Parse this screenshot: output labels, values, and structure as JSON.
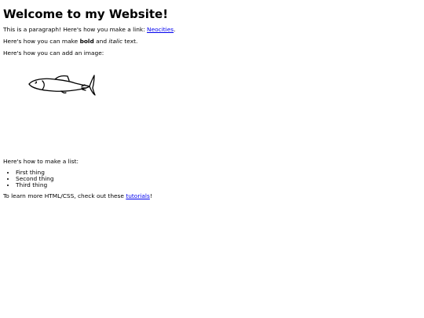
{
  "heading": "Welcome to my Website!",
  "para1": {
    "before": "This is a paragraph! Here's how you make a link: ",
    "link_text": "Neocities",
    "after": "."
  },
  "para2": {
    "before": "Here's how you can make ",
    "bold": "bold",
    "middle": " and ",
    "italic": "italic",
    "after": " text."
  },
  "para3": "Here's how you can add an image:",
  "image": {
    "icon": "fish-drawing"
  },
  "para4": "Here's how to make a list:",
  "list_items": [
    "First thing",
    "Second thing",
    "Third thing"
  ],
  "para5": {
    "before": "To learn more HTML/CSS, check out these ",
    "link_text": "tutorials",
    "after": "!"
  },
  "colors": {
    "link": "#0000ee",
    "text": "#000000",
    "background": "#ffffff"
  }
}
